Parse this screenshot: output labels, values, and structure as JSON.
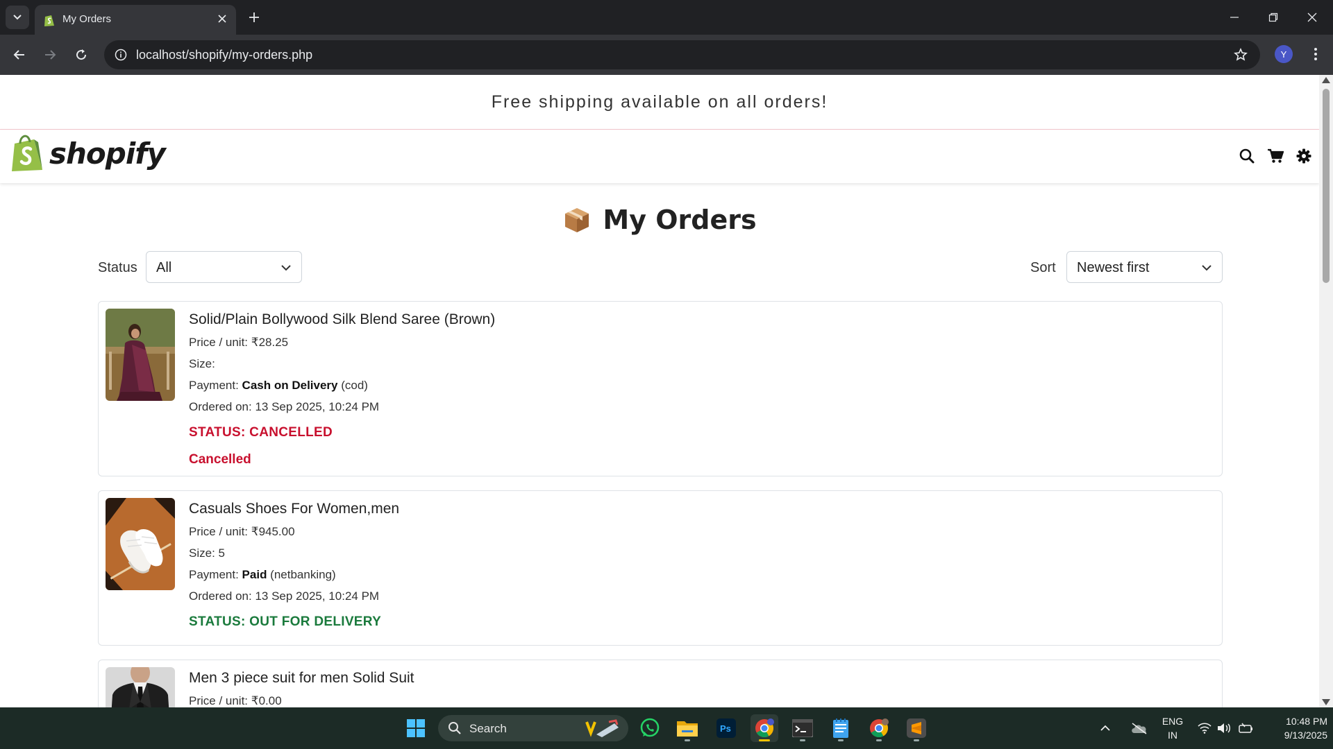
{
  "browser": {
    "tab_title": "My Orders",
    "url": "localhost/shopify/my-orders.php",
    "profile_initial": "Y"
  },
  "page": {
    "announcement": "Free shipping available on all orders!",
    "logo_text": "shopify",
    "title": "My Orders",
    "filters": {
      "status_label": "Status",
      "status_value": "All",
      "sort_label": "Sort",
      "sort_value": "Newest first"
    }
  },
  "orders": [
    {
      "title": "Solid/Plain Bollywood Silk Blend Saree (Brown)",
      "price": "Price / unit: ₹28.25",
      "size": "Size:",
      "payment_label": "Payment: ",
      "payment_method": "Cash on Delivery",
      "payment_code": " (cod)",
      "ordered_on": "Ordered on: 13 Sep 2025, 10:24 PM",
      "status": "STATUS: CANCELLED",
      "status_color": "#c8102e",
      "note": "Cancelled"
    },
    {
      "title": "Casuals Shoes For Women,men",
      "price": "Price / unit: ₹945.00",
      "size": "Size: 5",
      "payment_label": "Payment: ",
      "payment_method": "Paid",
      "payment_code": " (netbanking)",
      "ordered_on": "Ordered on: 13 Sep 2025, 10:24 PM",
      "status": "STATUS: OUT FOR DELIVERY",
      "status_color": "#1a7a3c"
    },
    {
      "title": "Men 3 piece suit for men Solid Suit",
      "price": "Price / unit: ₹0.00"
    }
  ],
  "taskbar": {
    "search_placeholder": "Search",
    "lang_1": "ENG",
    "lang_2": "IN",
    "time": "10:48 PM",
    "date": "9/13/2025"
  },
  "colors": {
    "shopify_green": "#95bf47",
    "shopify_dark_green": "#5e8e3e",
    "cancelled_red": "#c8102e",
    "delivery_green": "#1a7a3c"
  }
}
